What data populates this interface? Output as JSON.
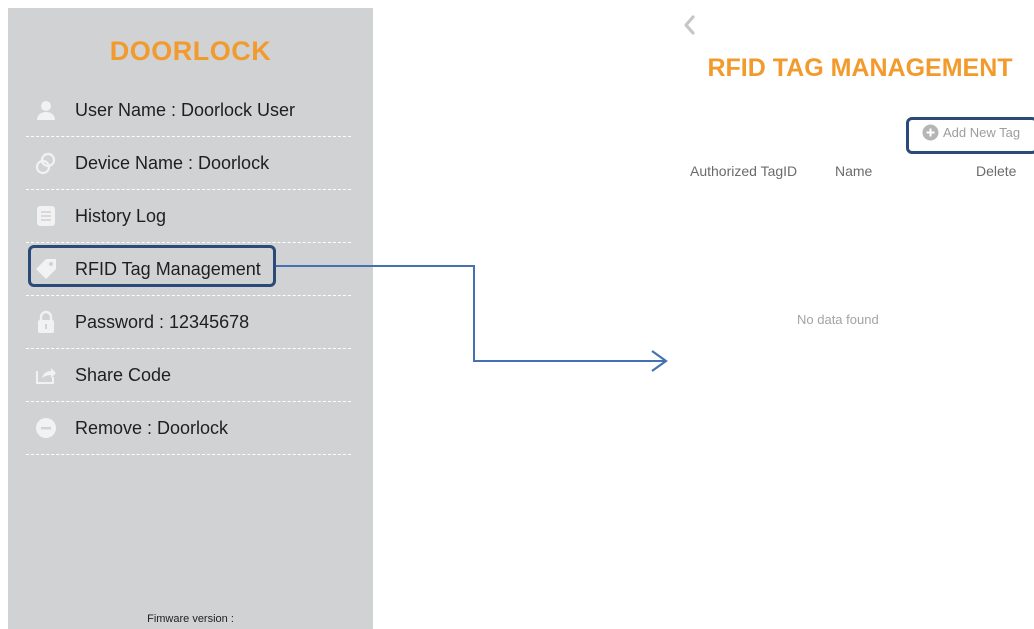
{
  "sidebar": {
    "brand": "DOORLOCK",
    "items": [
      {
        "icon": "user-icon",
        "label": "User Name : Doorlock User"
      },
      {
        "icon": "device-icon",
        "label": "Device Name : Doorlock"
      },
      {
        "icon": "history-icon",
        "label": "History Log"
      },
      {
        "icon": "tag-icon",
        "label": "RFID Tag Management"
      },
      {
        "icon": "lock-icon",
        "label": "Password : 12345678"
      },
      {
        "icon": "share-icon",
        "label": "Share Code"
      },
      {
        "icon": "remove-icon",
        "label": "Remove : Doorlock"
      }
    ],
    "firmware_label": "Fimware version :"
  },
  "screen": {
    "title": "RFID TAG MANAGEMENT",
    "add_button_label": "Add New Tag",
    "columns": [
      "Authorized TagID",
      "Name",
      "Delete"
    ],
    "empty_message": "No data found"
  },
  "colors": {
    "accent": "#f39a2c",
    "sidebar_bg": "#d1d2d4",
    "highlight": "#2c4a78",
    "arrow": "#4472b0"
  }
}
